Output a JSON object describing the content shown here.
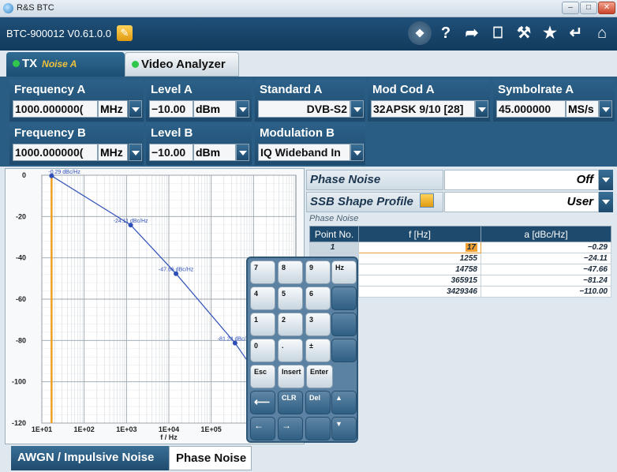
{
  "window": {
    "title": "R&S BTC",
    "controls": [
      "–",
      "□",
      "✕"
    ]
  },
  "toolbar": {
    "version": "BTC-900012 V0.61.0.0",
    "icons": [
      "windows-icon",
      "help-icon",
      "forward-icon",
      "save-icon",
      "wrench-icon",
      "star-icon",
      "undo-icon",
      "home-icon"
    ],
    "glyphs": [
      "❖",
      "?",
      "➦",
      "⎕",
      "⚒",
      "★",
      "↵",
      "⌂"
    ]
  },
  "tabs": {
    "tx_label": "TX",
    "tx_sub": "Noise A",
    "video_label": "Video Analyzer"
  },
  "params": {
    "freq_a": {
      "label": "Frequency A",
      "value": "1000.000000(",
      "unit": "MHz"
    },
    "level_a": {
      "label": "Level A",
      "value": "−10.00",
      "unit": "dBm"
    },
    "standard_a": {
      "label": "Standard A",
      "value": "DVB-S2"
    },
    "modcod_a": {
      "label": "Mod Cod A",
      "value": "32APSK 9/10 [28]"
    },
    "symbolrate_a": {
      "label": "Symbolrate A",
      "value": "45.000000",
      "unit": "MS/s"
    },
    "freq_b": {
      "label": "Frequency B",
      "value": "1000.000000(",
      "unit": "MHz"
    },
    "level_b": {
      "label": "Level B",
      "value": "−10.00",
      "unit": "dBm"
    },
    "modulation_b": {
      "label": "Modulation B",
      "value": "IQ Wideband In"
    }
  },
  "phase_noise": {
    "label": "Phase Noise",
    "value": "Off",
    "ssb_label": "SSB Shape Profile",
    "ssb_value": "User",
    "group_label": "Phase Noise",
    "table": {
      "headers": [
        "Point No.",
        "f [Hz]",
        "a [dBc/Hz]"
      ],
      "rows": [
        [
          "1",
          "17",
          "−0.29"
        ],
        [
          "",
          "1255",
          "−24.11"
        ],
        [
          "",
          "14758",
          "−47.66"
        ],
        [
          "",
          "365915",
          "−81.24"
        ],
        [
          "",
          "3429346",
          "−110.00"
        ]
      ]
    }
  },
  "keypad": {
    "keys": [
      "7",
      "8",
      "9",
      "Hz",
      "4",
      "5",
      "6",
      "",
      "1",
      "2",
      "3",
      "",
      "0",
      ".",
      "±",
      "",
      "Esc",
      "Insert",
      "Enter",
      "⟵",
      "CLR",
      "Del",
      "▲",
      "←",
      "→",
      "",
      "▼"
    ]
  },
  "chart_data": {
    "type": "line",
    "xlabel": "f / Hz",
    "x_scale": "log",
    "xlim": [
      10,
      10000000
    ],
    "ylim": [
      -120,
      0
    ],
    "x_tick_labels": [
      "1E+01",
      "1E+02",
      "1E+03",
      "1E+04",
      "1E+05",
      "1E+"
    ],
    "y_tick_labels": [
      "0",
      "-20",
      "-40",
      "-60",
      "-80",
      "-100",
      "-120"
    ],
    "grid": true,
    "series": [
      {
        "x": [
          17,
          1255,
          14758,
          365915,
          3429346
        ],
        "y": [
          -0.29,
          -24.11,
          -47.66,
          -81.24,
          -110.0
        ]
      }
    ],
    "point_labels": [
      "-0.29 dBc/Hz",
      "-24.11 dBc/Hz",
      "-47.66 dBc/Hz",
      "-81.24 dBc/Hz"
    ],
    "colors": {
      "line": "#2f4fb8",
      "marker": "#f0a020",
      "grid": "#9aa4ad"
    }
  }
}
